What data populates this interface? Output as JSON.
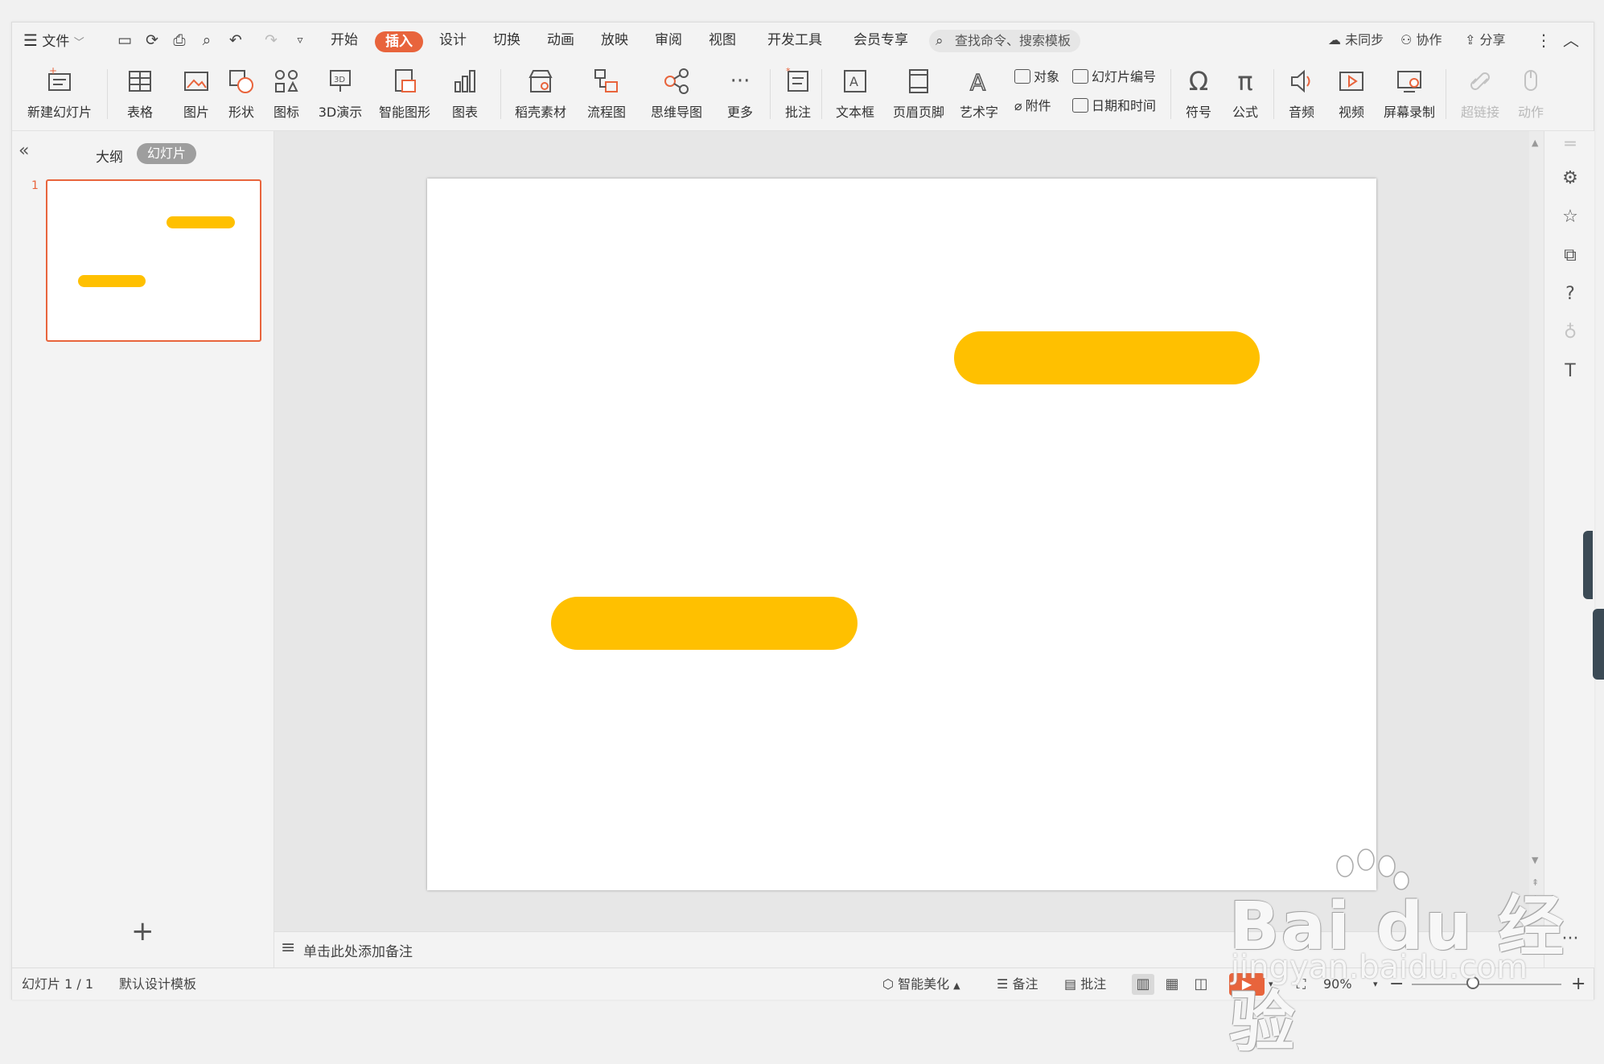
{
  "menubar": {
    "file": "文件",
    "tabs": [
      {
        "label": "开始"
      },
      {
        "label": "插入"
      },
      {
        "label": "设计"
      },
      {
        "label": "切换"
      },
      {
        "label": "动画"
      },
      {
        "label": "放映"
      },
      {
        "label": "审阅"
      },
      {
        "label": "视图"
      },
      {
        "label": "开发工具"
      },
      {
        "label": "会员专享"
      }
    ],
    "search_placeholder": "查找命令、搜索模板",
    "sync": "未同步",
    "collab": "协作",
    "share": "分享"
  },
  "ribbon": {
    "new_slide": "新建幻灯片",
    "table": "表格",
    "picture": "图片",
    "shape": "形状",
    "icon": "图标",
    "demo3d": "3D演示",
    "smartart": "智能图形",
    "chart": "图表",
    "docer": "稻壳素材",
    "flowchart": "流程图",
    "mindmap": "思维导图",
    "more": "更多",
    "comment": "批注",
    "textbox": "文本框",
    "header_footer": "页眉页脚",
    "wordart": "艺术字",
    "object": "对象",
    "slide_number": "幻灯片编号",
    "attachment": "附件",
    "datetime": "日期和时间",
    "symbol": "符号",
    "formula": "公式",
    "audio": "音频",
    "video": "视频",
    "screen_record": "屏幕录制",
    "hyperlink": "超链接",
    "action": "动作"
  },
  "left_panel": {
    "outline_tab": "大纲",
    "slides_tab": "幻灯片",
    "slide_index": "1"
  },
  "notes_placeholder": "单击此处添加备注",
  "status": {
    "slide_counter": "幻灯片 1 / 1",
    "template": "默认设计模板",
    "beautify": "智能美化",
    "notes": "备注",
    "comments": "批注",
    "zoom": "90%"
  },
  "watermark": {
    "brand": "Bai du 经验",
    "url": "jingyan.baidu.com"
  },
  "colors": {
    "accent": "#e8643c",
    "shape_fill": "#ffc000"
  },
  "icons": [
    "menu-icon",
    "save-icon",
    "print-icon",
    "undo-icon",
    "redo-icon",
    "search-icon",
    "cloud-icon",
    "user-icon",
    "share-icon",
    "more-vertical-icon",
    "collapse-icon",
    "plus-icon",
    "notes-icon",
    "play-icon"
  ]
}
